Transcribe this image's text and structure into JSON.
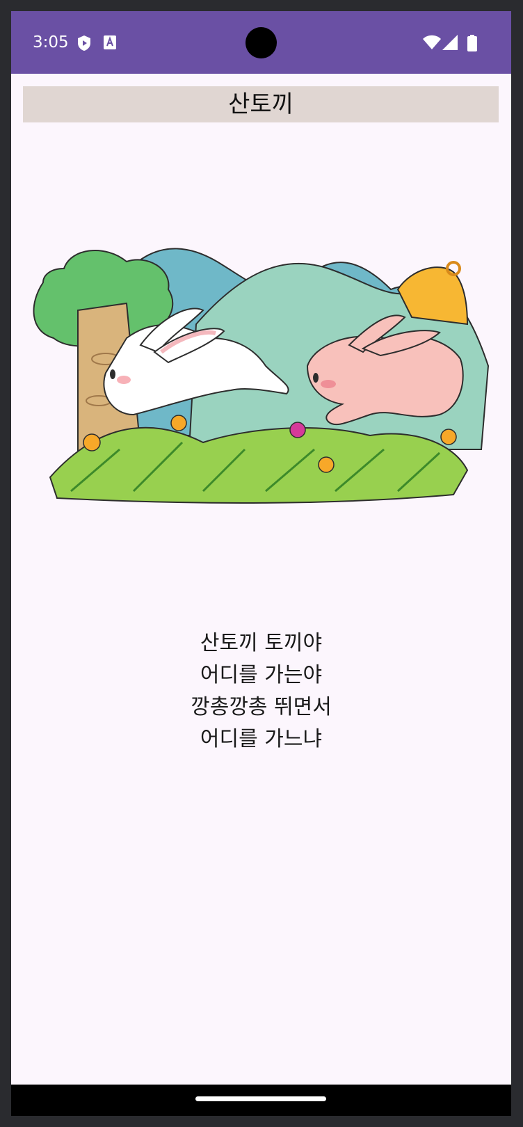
{
  "status_bar": {
    "time": "3:05",
    "left_icons": [
      "shield-play-icon",
      "text-a-icon"
    ],
    "right_icons": [
      "wifi-icon",
      "signal-icon",
      "battery-icon"
    ],
    "bg_color": "#6a50a4"
  },
  "title": "산토끼",
  "illustration": {
    "subject": "two rabbits running over hills",
    "icons": [
      "tree-icon",
      "mountains-icon",
      "bell-icon",
      "white-rabbit-icon",
      "pink-rabbit-icon",
      "flower-icon",
      "grass-icon"
    ]
  },
  "lyrics": [
    "산토끼 토끼야",
    "어디를 가는야",
    "깡총깡총 뛰면서",
    "어디를 가느냐"
  ],
  "colors": {
    "title_bg": "#e0d6d2",
    "page_bg": "#fcf6fd"
  }
}
